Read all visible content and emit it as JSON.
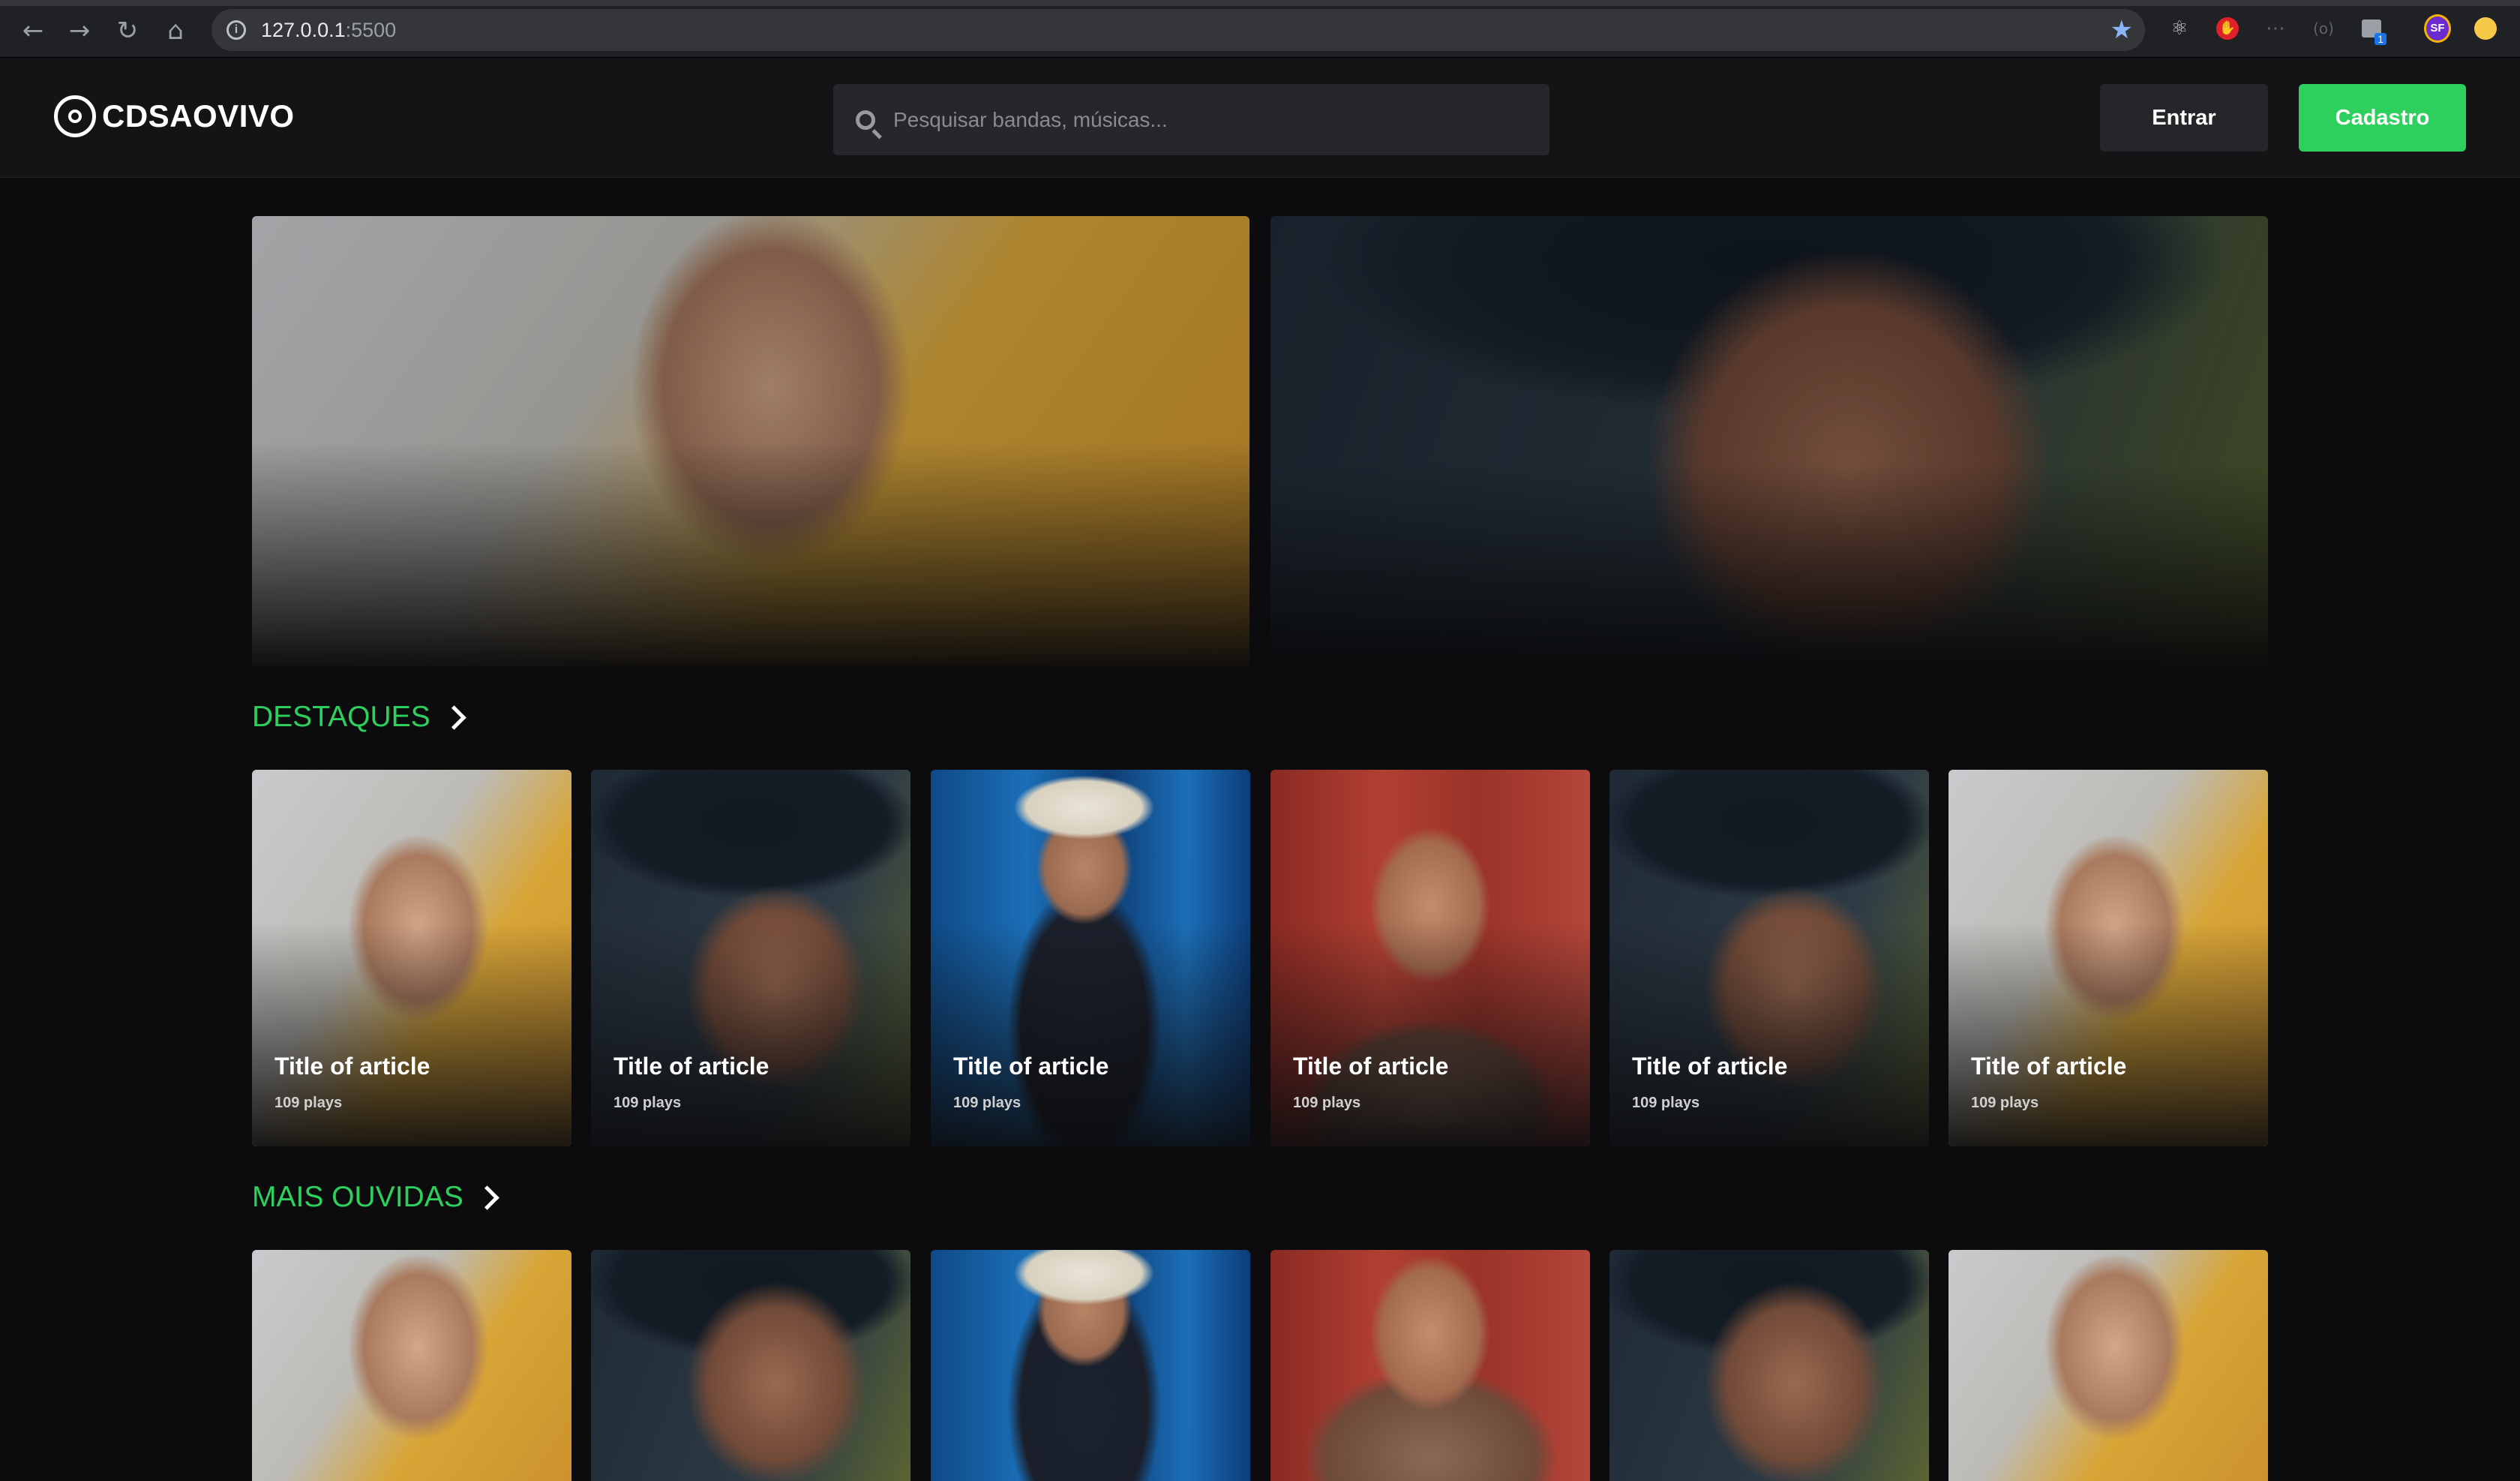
{
  "browser": {
    "url_host": "127.0.0.1",
    "url_port": ":5500",
    "back_icon": "arrow-left-icon",
    "forward_icon": "arrow-right-icon",
    "reload_icon": "reload-icon",
    "home_icon": "home-icon",
    "extensions": [
      "react-devtools-icon",
      "adblock-icon",
      "extension-icon",
      "extension-icon",
      "extension-badge-icon",
      "profile-sf-icon",
      "extension-yellow-icon"
    ],
    "ext_badge": "1",
    "profile_initials": "SF"
  },
  "header": {
    "logo_text": "CDSAOVIVO",
    "search_placeholder": "Pesquisar bandas, músicas...",
    "login_label": "Entrar",
    "signup_label": "Cadastro"
  },
  "colors": {
    "accent": "#2ed05d",
    "background": "#0c0c0e",
    "header": "#141416"
  },
  "sections": [
    {
      "title": "DESTAQUES",
      "cards": [
        {
          "title": "Title of article",
          "plays": "109 plays"
        },
        {
          "title": "Title of article",
          "plays": "109 plays"
        },
        {
          "title": "Title of article",
          "plays": "109 plays"
        },
        {
          "title": "Title of article",
          "plays": "109 plays"
        },
        {
          "title": "Title of article",
          "plays": "109 plays"
        },
        {
          "title": "Title of article",
          "plays": "109 plays"
        }
      ]
    },
    {
      "title": "MAIS OUVIDAS"
    }
  ]
}
